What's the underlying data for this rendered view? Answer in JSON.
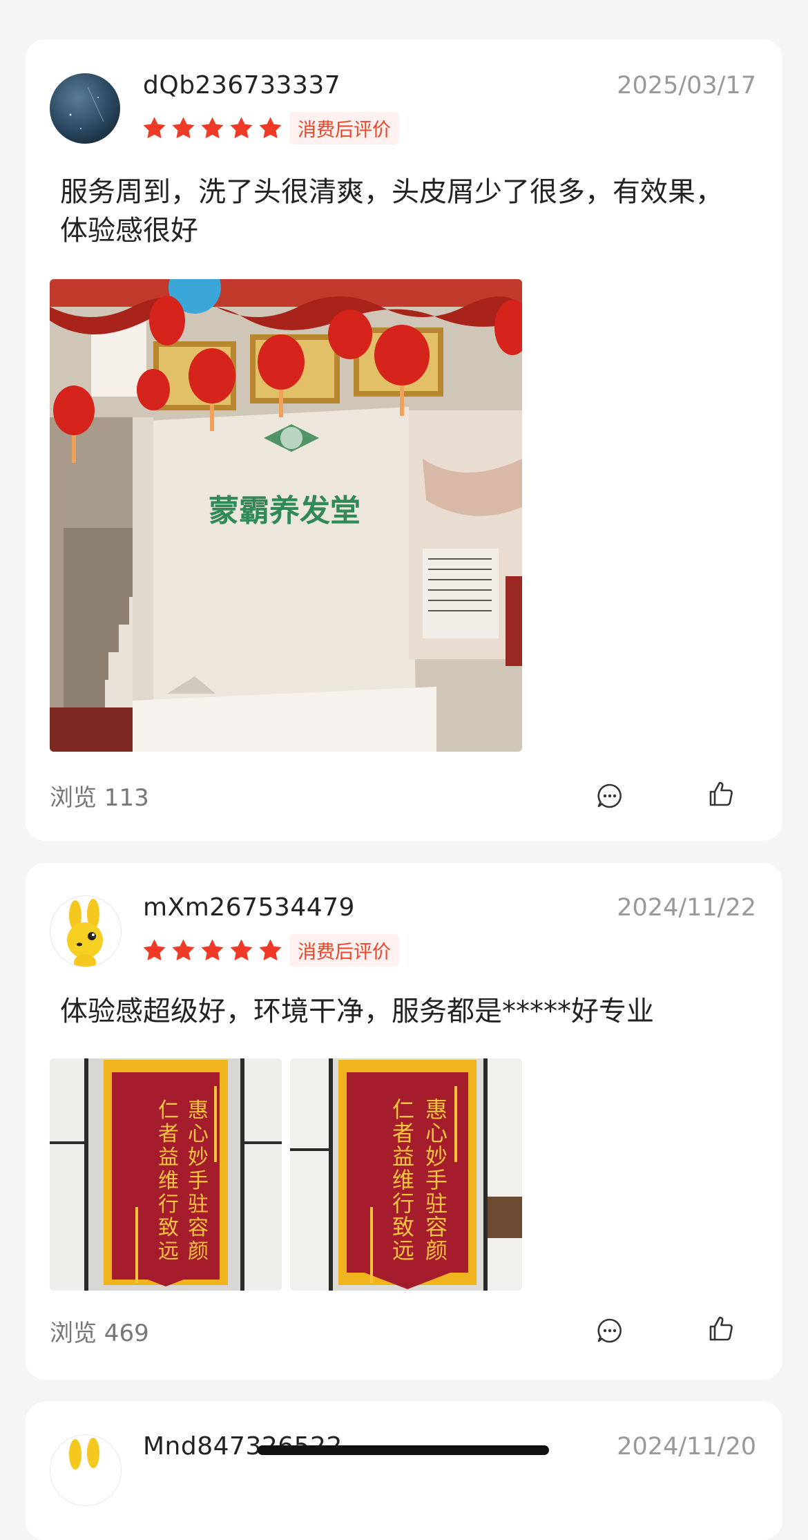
{
  "reviews": [
    {
      "username": "dQb236733337",
      "date": "2025/03/17",
      "rating": 5,
      "badge": "消费后评价",
      "text": "服务周到，洗了头很清爽，头皮屑少了很多，有效果，体验感很好",
      "photo_sign": "蒙霸养发堂",
      "views": "浏览 113"
    },
    {
      "username": "mXm267534479",
      "date": "2024/11/22",
      "rating": 5,
      "badge": "消费后评价",
      "text": "体验感超级好，环境干净，服务都是*****好专业",
      "banner_col_right": "惠心妙手驻容颜",
      "banner_col_left": "仁者益维行致远",
      "views": "浏览 469"
    },
    {
      "username": "Mnd847326522",
      "date": "2024/11/20"
    }
  ],
  "colors": {
    "star": "#ee3a26",
    "badge_text": "#e8462a",
    "badge_bg": "#fff1ef",
    "background": "#f5f5f7"
  },
  "icons": [
    "comment-icon",
    "thumbs-up-icon",
    "star-icon"
  ]
}
